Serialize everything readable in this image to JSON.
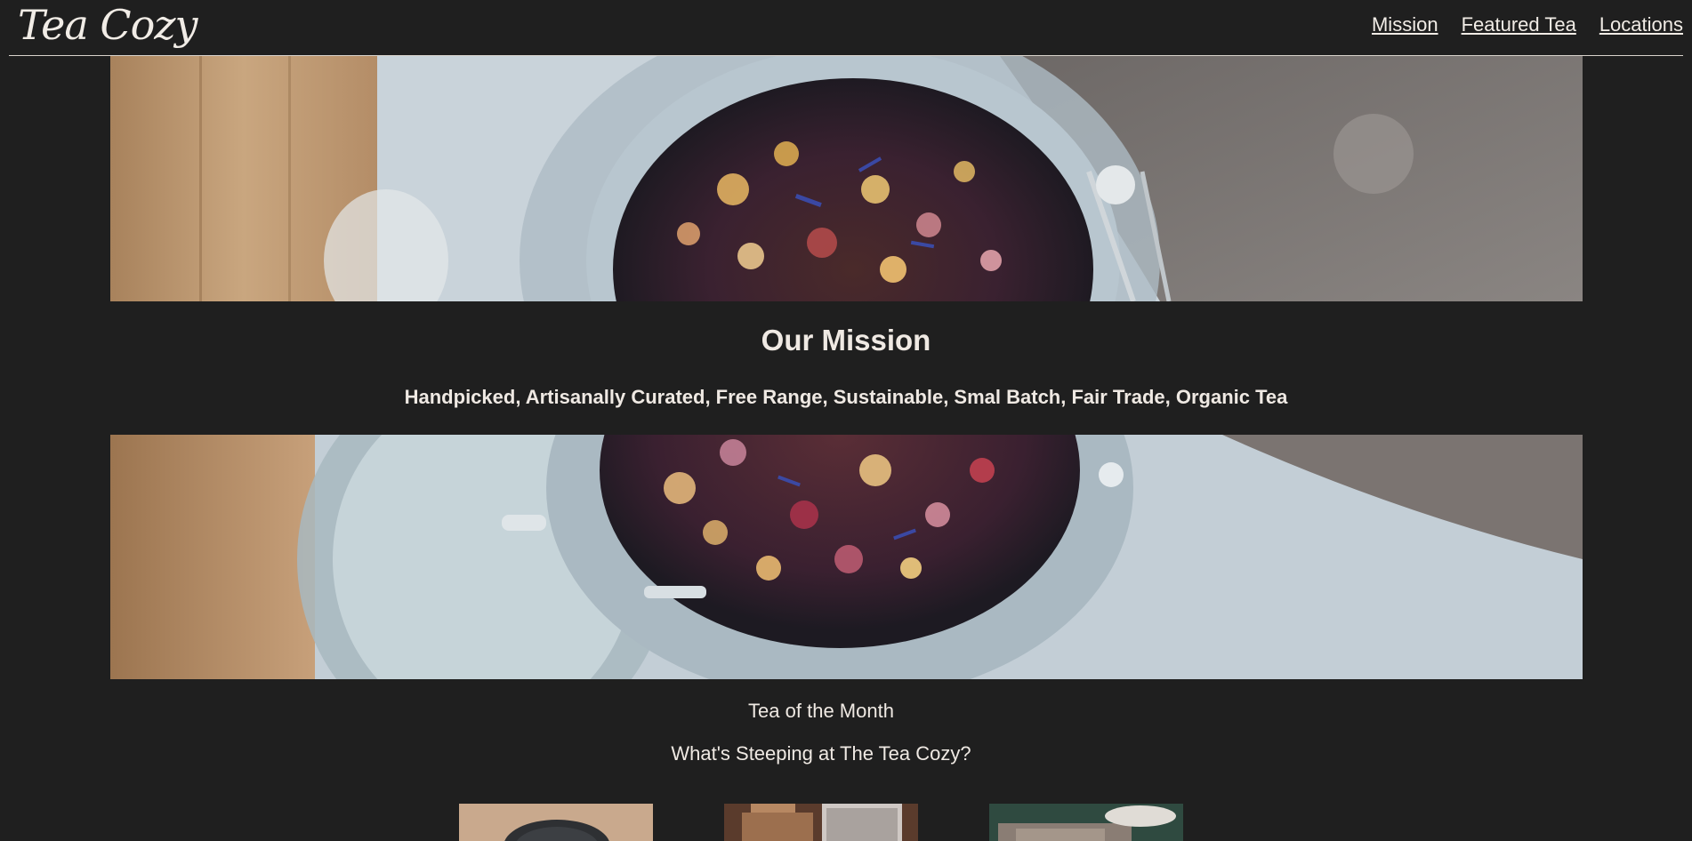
{
  "header": {
    "logo": "Tea Cozy",
    "nav": [
      {
        "label": "Mission"
      },
      {
        "label": "Featured Tea"
      },
      {
        "label": "Locations"
      }
    ]
  },
  "mission": {
    "title": "Our Mission",
    "subtitle": "Handpicked, Artisanally Curated, Free Range, Sustainable, Smal Batch, Fair Trade, Organic Tea"
  },
  "featured": {
    "title": "Tea of the Month",
    "subtitle": "What's Steeping at The Tea Cozy?"
  },
  "colors": {
    "background": "#1f1f1f",
    "text": "#efe9e3"
  }
}
